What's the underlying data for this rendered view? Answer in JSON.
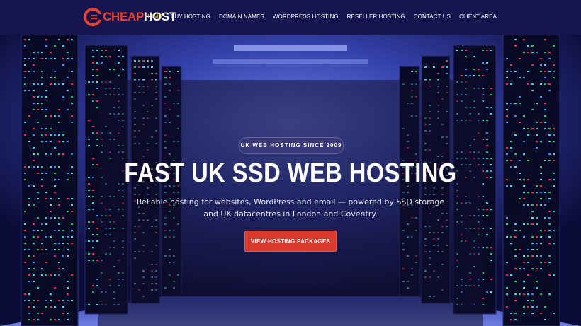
{
  "brand": {
    "name_prefix": "CHEAP",
    "name_suffix": "HOST",
    "accent": "#e8412c"
  },
  "nav": {
    "items": [
      {
        "label": "Home",
        "active": true
      },
      {
        "label": "Buy Hosting"
      },
      {
        "label": "Domain Names"
      },
      {
        "label": "WordPress Hosting"
      },
      {
        "label": "Reseller Hosting"
      },
      {
        "label": "Contact Us"
      },
      {
        "label": "Client Area"
      }
    ]
  },
  "hero": {
    "badge": "UK WEB HOSTING SINCE 2009",
    "headline": "FAST UK SSD WEB HOSTING",
    "subline_1": "Reliable hosting for websites, WordPress and email — powered by SSD storage",
    "subline_2": "and UK datacentres in London and Coventry.",
    "cta": "View Hosting Packages"
  },
  "colors": {
    "nav_bg": "#171550",
    "cta_bg": "#d93a2b",
    "active_link": "#f3d24a"
  }
}
